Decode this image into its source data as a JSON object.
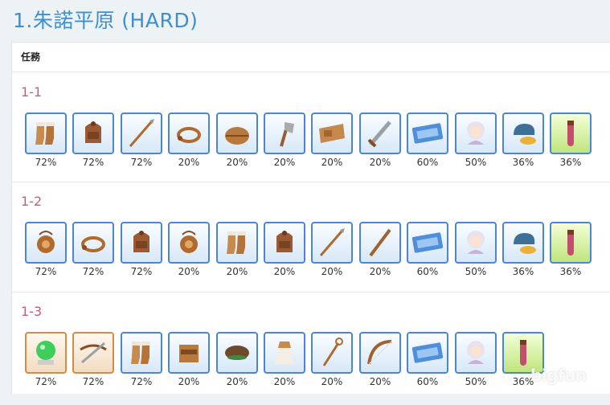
{
  "page_title": "1.朱諾平原 (HARD)",
  "table_header": "任務",
  "watermark": "bigfun",
  "stages": [
    {
      "label": "1-1",
      "items": [
        {
          "icon": "boots-icon",
          "rate": "72%"
        },
        {
          "icon": "backpack-icon",
          "rate": "72%"
        },
        {
          "icon": "spear-icon",
          "rate": "72%"
        },
        {
          "icon": "bracelet-icon",
          "rate": "20%"
        },
        {
          "icon": "hat-icon",
          "rate": "20%"
        },
        {
          "icon": "axe-icon",
          "rate": "20%"
        },
        {
          "icon": "belt-icon",
          "rate": "20%"
        },
        {
          "icon": "sword-icon",
          "rate": "20%"
        },
        {
          "icon": "ticket-icon",
          "rate": "60%"
        },
        {
          "icon": "character-shard-icon",
          "rate": "50%"
        },
        {
          "icon": "helmet-coins-icon",
          "rate": "36%"
        },
        {
          "icon": "potion-icon",
          "rate": "36%"
        }
      ]
    },
    {
      "label": "1-2",
      "items": [
        {
          "icon": "amulet-icon",
          "rate": "72%"
        },
        {
          "icon": "bracelet-icon",
          "rate": "72%"
        },
        {
          "icon": "backpack-icon",
          "rate": "72%"
        },
        {
          "icon": "amulet-icon",
          "rate": "20%"
        },
        {
          "icon": "boots-icon",
          "rate": "20%"
        },
        {
          "icon": "backpack-icon",
          "rate": "20%"
        },
        {
          "icon": "spear-icon",
          "rate": "20%"
        },
        {
          "icon": "staff-icon",
          "rate": "20%"
        },
        {
          "icon": "ticket-icon",
          "rate": "60%"
        },
        {
          "icon": "character-shard-icon",
          "rate": "50%"
        },
        {
          "icon": "helmet-coins-icon",
          "rate": "36%"
        },
        {
          "icon": "potion-icon",
          "rate": "36%"
        }
      ]
    },
    {
      "label": "1-3",
      "items": [
        {
          "icon": "crystal-ball-icon",
          "rate": "72%"
        },
        {
          "icon": "crossbow-icon",
          "rate": "72%"
        },
        {
          "icon": "boots-icon",
          "rate": "72%"
        },
        {
          "icon": "gauntlet-icon",
          "rate": "20%"
        },
        {
          "icon": "cap-icon",
          "rate": "20%"
        },
        {
          "icon": "dress-icon",
          "rate": "20%"
        },
        {
          "icon": "wand-icon",
          "rate": "20%"
        },
        {
          "icon": "bow-icon",
          "rate": "20%"
        },
        {
          "icon": "ticket-icon",
          "rate": "60%"
        },
        {
          "icon": "character-shard-icon",
          "rate": "50%"
        },
        {
          "icon": "potion-icon",
          "rate": "36%"
        }
      ]
    }
  ],
  "colors": {
    "title": "#3d8fd0",
    "stage_label": "#c65b7a",
    "frame_border": "#4b86d6"
  }
}
